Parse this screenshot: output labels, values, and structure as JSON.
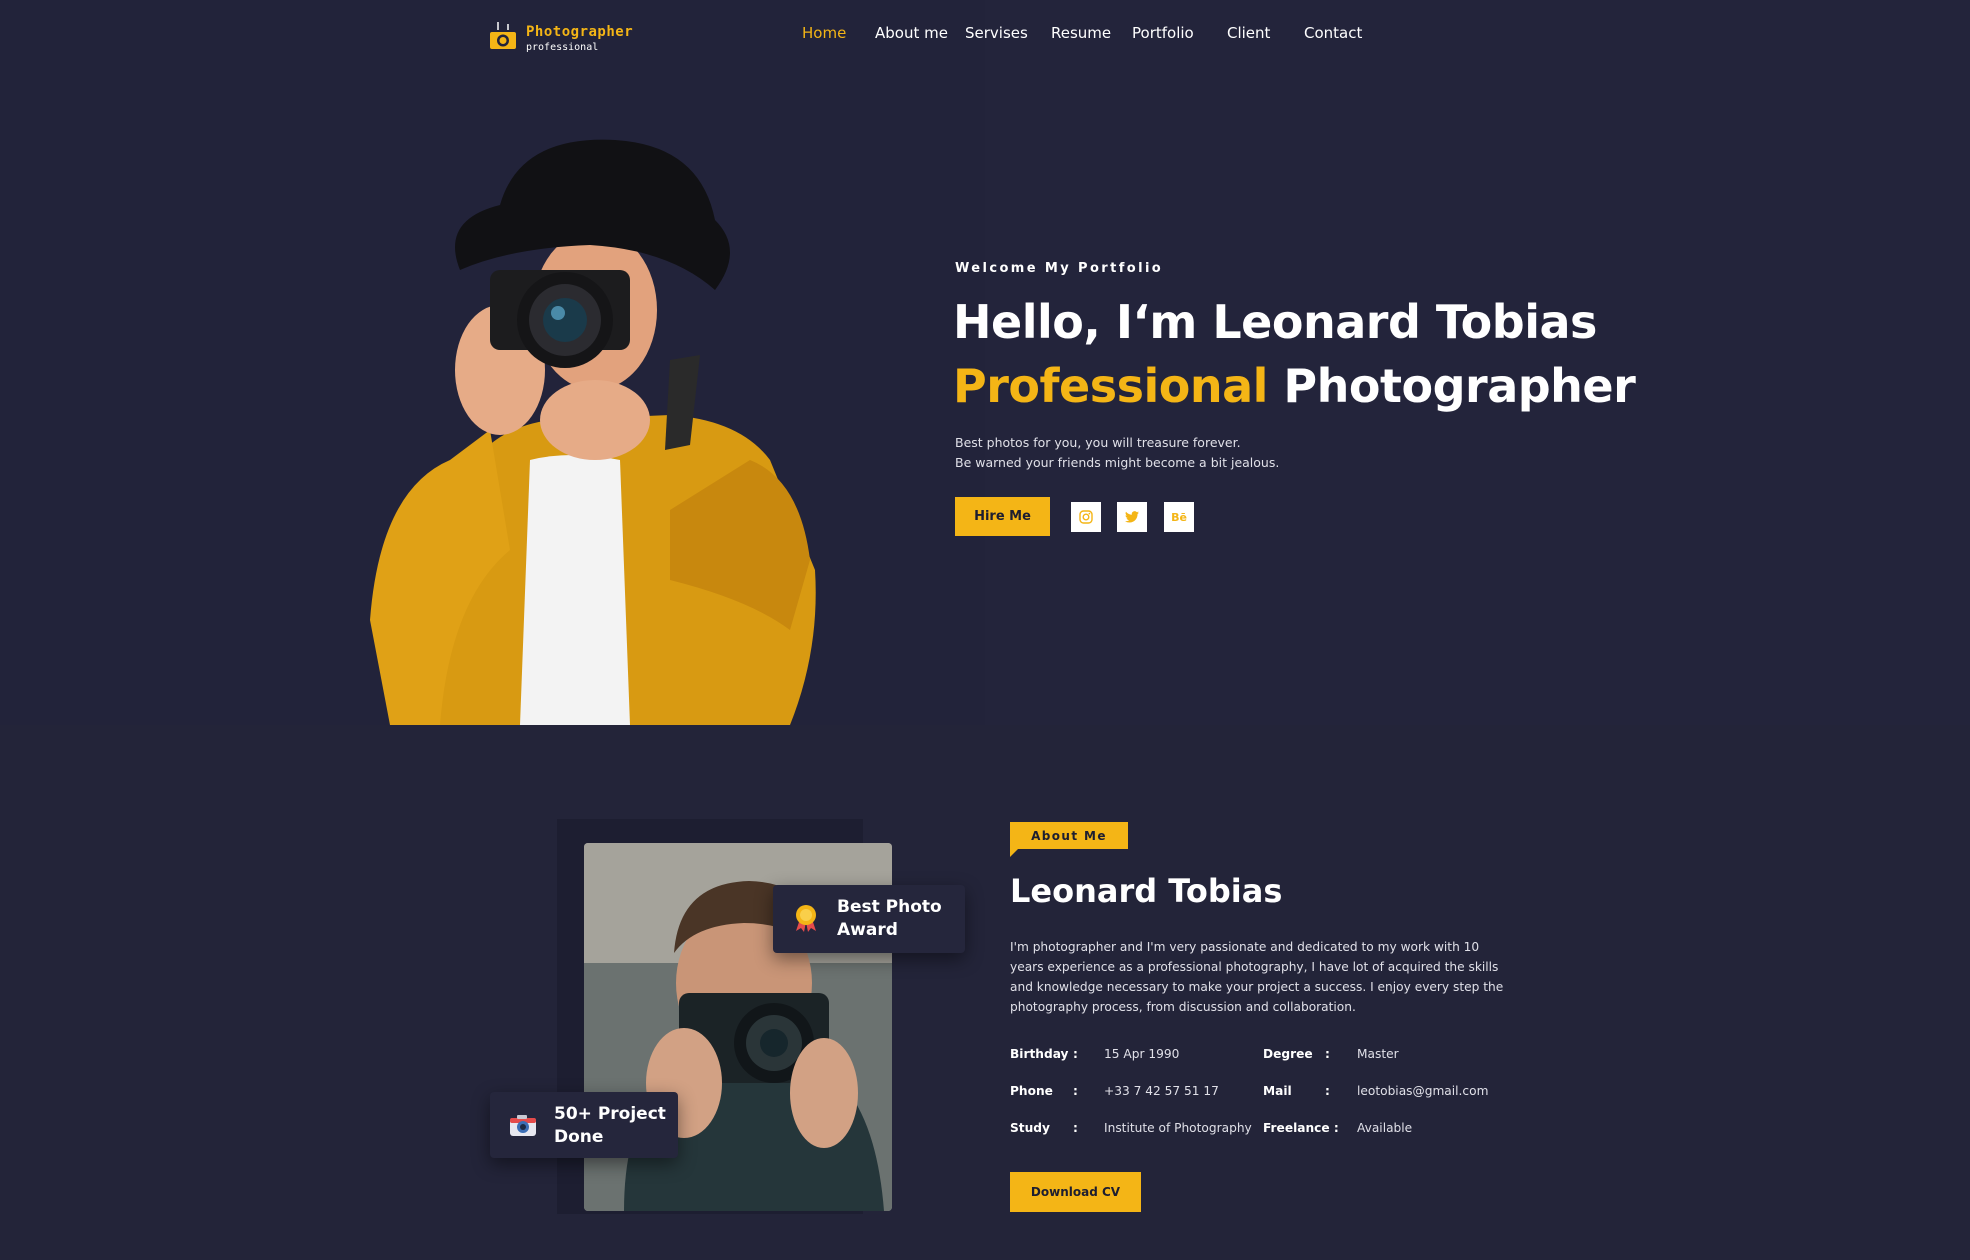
{
  "logo": {
    "title": "Photographer",
    "subtitle": "professional"
  },
  "nav": {
    "items": [
      {
        "label": "Home",
        "active": true
      },
      {
        "label": "About me",
        "active": false
      },
      {
        "label": "Servises",
        "active": false
      },
      {
        "label": "Resume",
        "active": false
      },
      {
        "label": "Portfolio",
        "active": false
      },
      {
        "label": "Client",
        "active": false
      },
      {
        "label": "Contact",
        "active": false
      }
    ]
  },
  "hero": {
    "kicker": "Welcome My Portfolio",
    "title_line1": "Hello, I‘m Leonard Tobias",
    "title_accent": "Professional",
    "title_rest": " Photographer",
    "desc_line1": "Best photos for you, you will treasure forever.",
    "desc_line2": "Be warned your friends might become a bit jealous.",
    "hire_label": "Hire Me",
    "socials": [
      "instagram-icon",
      "twitter-icon",
      "behance-icon"
    ],
    "behance_text": "Bē"
  },
  "about": {
    "tag": "About Me",
    "name": "Leonard Tobias",
    "description": "I'm photographer and I'm very passionate and dedicated to my work with 10 years experience as a professional photography, I have lot of acquired the skills and knowledge necessary to make your project a success. I enjoy every step the photography process, from discussion and collaboration.",
    "award_line1": "Best Photo",
    "award_line2": "Award",
    "project_line1": "50+ Project",
    "project_line2": "Done",
    "info": {
      "birthday_label": "Birthday",
      "birthday_value": "15 Apr 1990",
      "phone_label": "Phone",
      "phone_value": "+33 7 42 57 51 17",
      "study_label": "Study",
      "study_value": "Institute of Photography",
      "degree_label": "Degree",
      "degree_value": "Master",
      "mail_label": "Mail",
      "mail_value": "leotobias@gmail.com",
      "freelance_label": "Freelance :",
      "freelance_value": "Available",
      "colon": ":"
    },
    "cv_label": "Download CV"
  },
  "colors": {
    "background": "#22233a",
    "accent": "#f4b516",
    "card": "#25263c"
  }
}
